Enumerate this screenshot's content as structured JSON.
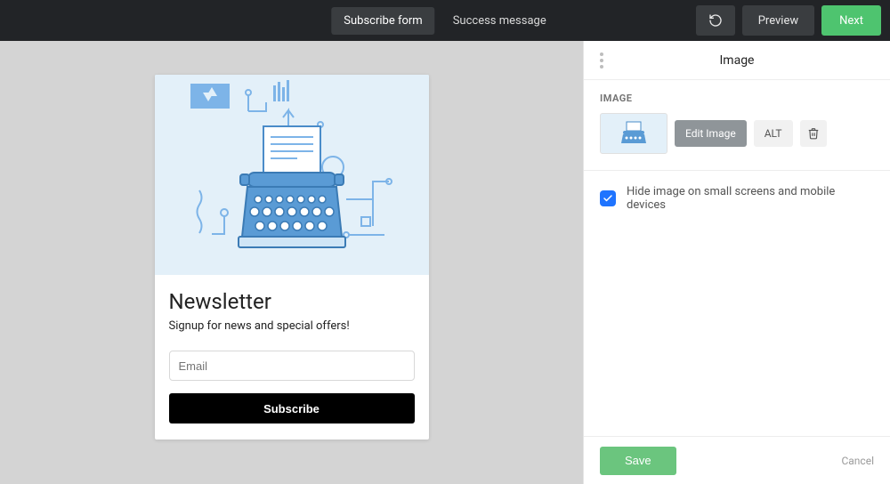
{
  "topbar": {
    "tabs": {
      "subscribe": "Subscribe form",
      "success": "Success message"
    },
    "preview": "Preview",
    "next": "Next"
  },
  "form": {
    "title": "Newsletter",
    "subtitle": "Signup for news and special offers!",
    "email_placeholder": "Email",
    "subscribe": "Subscribe"
  },
  "panel": {
    "title": "Image",
    "section_label": "IMAGE",
    "edit": "Edit Image",
    "alt": "ALT",
    "hide_label": "Hide image on small screens and mobile devices",
    "hide_checked": true,
    "save": "Save",
    "cancel": "Cancel"
  }
}
